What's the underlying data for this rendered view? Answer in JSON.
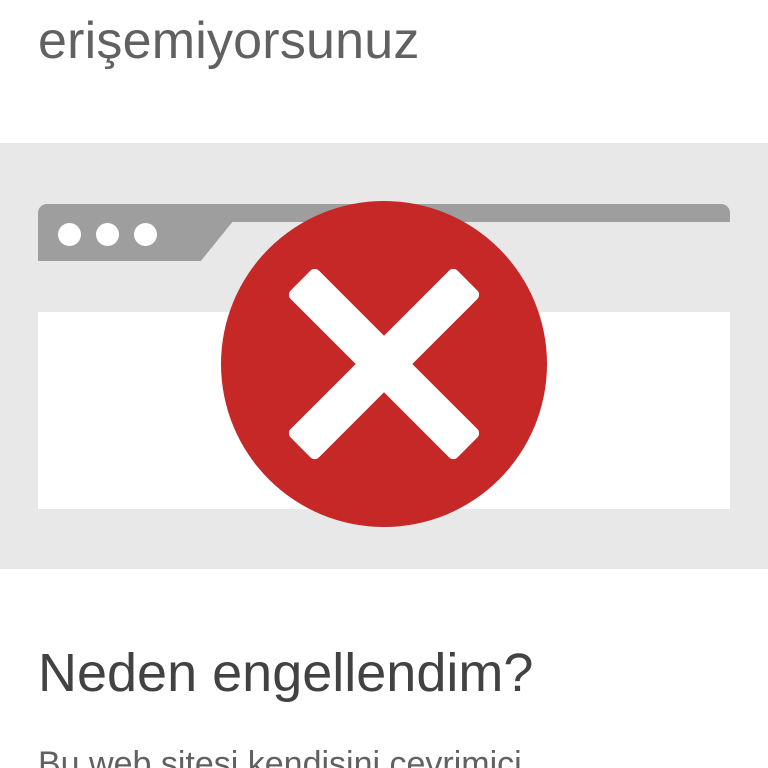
{
  "header": {
    "title_partial": "erişemiyorsunuz"
  },
  "hero": {
    "icon": "blocked-x-icon",
    "colors": {
      "background": "#e8e8e8",
      "browser_bar": "#9e9e9e",
      "error_circle": "#c62828",
      "x_mark": "#ffffff"
    }
  },
  "content": {
    "heading": "Neden engellendim?",
    "body_partial": "Bu web sitesi kendisini çevrimiçi"
  }
}
